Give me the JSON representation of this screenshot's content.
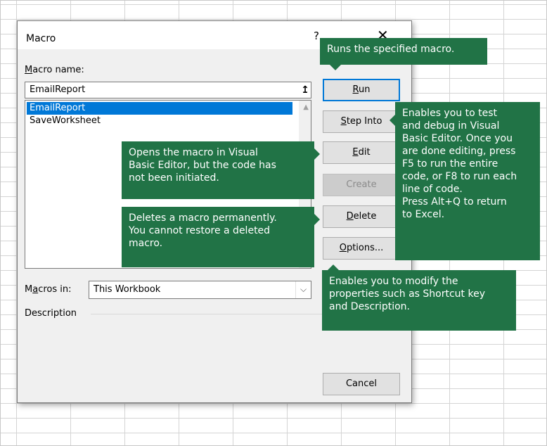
{
  "dialog": {
    "title": "Macro",
    "help_label": "?",
    "close_label": "✕",
    "macro_name_label_u": "M",
    "macro_name_label_rest": "acro name:",
    "macro_name_value": "EmailReport",
    "upload_icon": "↥",
    "list": [
      "EmailReport",
      "SaveWorksheet"
    ],
    "scroll_up_icon": "▲",
    "macros_in_label_pre": "M",
    "macros_in_label_u": "a",
    "macros_in_label_rest": "cros in:",
    "macros_in_value": "This Workbook",
    "combo_arrow_icon": "⌵",
    "description_label": "Description"
  },
  "buttons": {
    "run_u": "R",
    "run_rest": "un",
    "step_u": "S",
    "step_rest": "tep Into",
    "edit_u": "E",
    "edit_rest": "dit",
    "create": "Create",
    "delete_u": "D",
    "delete_rest": "elete",
    "options_u": "O",
    "options_rest": "ptions...",
    "cancel": "Cancel"
  },
  "callouts": {
    "run": [
      "Runs the specified macro."
    ],
    "step": [
      "Enables you to test",
      "and debug in Visual",
      "Basic Editor. Once you",
      "are done editing, press",
      "F5 to run the entire",
      "code, or F8 to run each",
      "line of code.",
      "Press Alt+Q to return",
      "to Excel."
    ],
    "edit": [
      "Opens the macro in Visual",
      "Basic Editor, but the code has",
      "not been initiated."
    ],
    "delete": [
      "Deletes a macro permanently.",
      "You cannot restore a deleted",
      "macro."
    ],
    "options": [
      "Enables you to modify the",
      "properties such as Shortcut key",
      "and Description."
    ]
  },
  "colors": {
    "callout_bg": "#217346",
    "selection": "#0078d7"
  }
}
